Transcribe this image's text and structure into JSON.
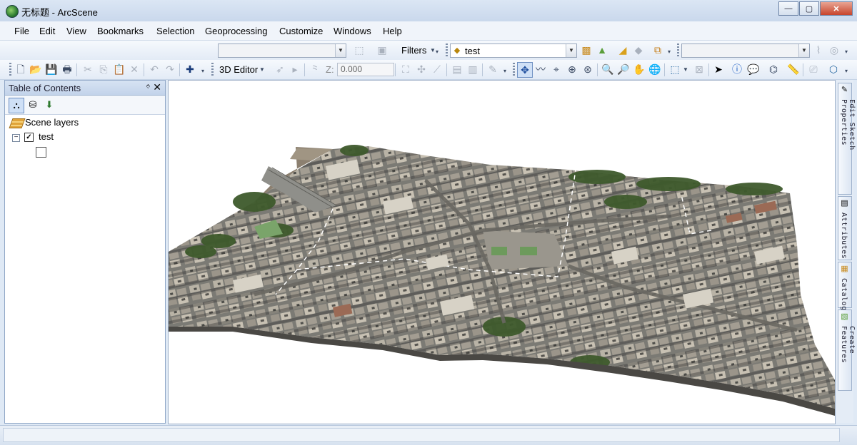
{
  "window": {
    "title": "无标题 - ArcScene",
    "minimize": "—",
    "maximize": "▢",
    "close": "✕"
  },
  "menu": [
    "File",
    "Edit",
    "View",
    "Bookmarks",
    "Selection",
    "Geoprocessing",
    "Customize",
    "Windows",
    "Help"
  ],
  "toolbar": {
    "filters_label": "Filters",
    "layer_combo_value": "test",
    "editor_label": "3D Editor",
    "z_label": "Z:",
    "z_value": "0.000"
  },
  "toc": {
    "title": "Table of Contents",
    "pin": "ᛜ",
    "close": "✕",
    "root_label": "Scene layers",
    "layer_name": "test",
    "layer_checked": "✓",
    "expander": "−"
  },
  "right_dock": {
    "tabs": [
      "Edit Sketch Properties",
      "Attributes",
      "Catalog",
      "Create Features"
    ]
  },
  "colors": {
    "title_bg": "#c9d8ec",
    "scene_bg": "#ffffff",
    "toc_header": "#c2d3ea"
  }
}
